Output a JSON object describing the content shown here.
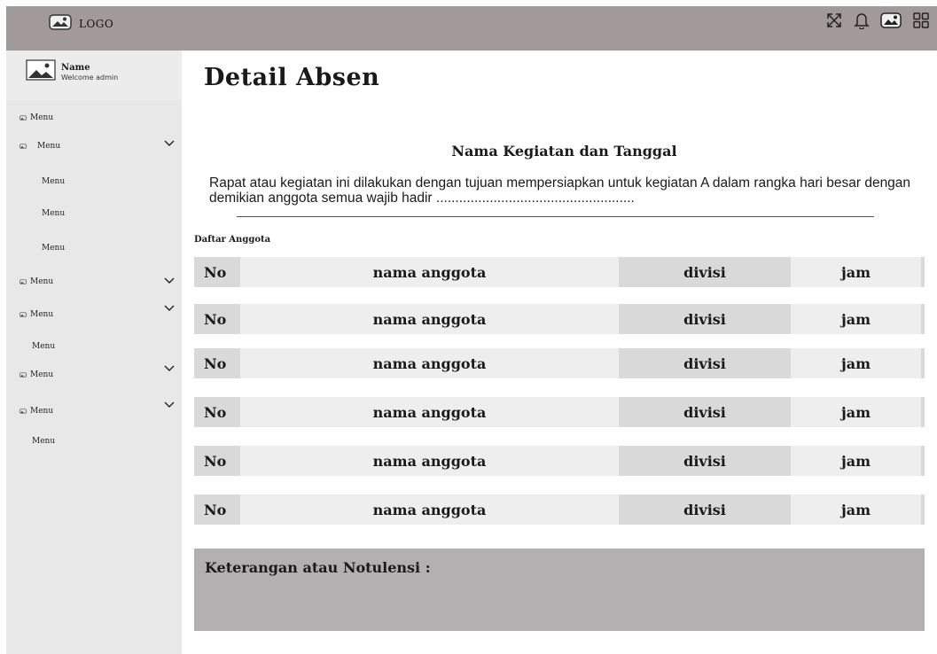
{
  "header": {
    "logo_text": "LOGO",
    "icons": [
      "fullscreen-icon",
      "bell-icon",
      "image-icon",
      "grid-icon"
    ]
  },
  "sidebar": {
    "profile": {
      "name": "Name",
      "welcome": "Welcome admin"
    },
    "items": [
      {
        "label": "Menu"
      },
      {
        "label": "Menu"
      },
      {
        "label": "Menu"
      },
      {
        "label": "Menu"
      },
      {
        "label": "Menu"
      },
      {
        "label": "Menu"
      },
      {
        "label": "Menu"
      },
      {
        "label": "Menu"
      },
      {
        "label": "Menu"
      },
      {
        "label": "Menu"
      },
      {
        "label": "Menu"
      }
    ]
  },
  "main": {
    "page_title": "Detail Absen",
    "event_title": "Nama Kegiatan dan Tanggal",
    "event_description": "Rapat atau kegiatan ini dilakukan dengan tujuan mempersiapkan untuk kegiatan A dalam rangka hari besar dengan demikian anggota semua wajib hadir ....................................................",
    "member_section_label": "Daftar Anggota",
    "rows": [
      {
        "no": "No",
        "name": "nama anggota",
        "division": "divisi",
        "time": "jam"
      },
      {
        "no": "No",
        "name": "nama anggota",
        "division": "divisi",
        "time": "jam"
      },
      {
        "no": "No",
        "name": "nama anggota",
        "division": "divisi",
        "time": "jam"
      },
      {
        "no": "No",
        "name": "nama anggota",
        "division": "divisi",
        "time": "jam"
      },
      {
        "no": "No",
        "name": "nama anggota",
        "division": "divisi",
        "time": "jam"
      },
      {
        "no": "No",
        "name": "nama anggota",
        "division": "divisi",
        "time": "jam"
      }
    ],
    "notes_label": "Keterangan atau Notulensi :"
  },
  "colors": {
    "topbar": "#a29a9a",
    "sidebar": "#e8e8e8",
    "notes_bg": "#b2b0b0",
    "cell_dark": "#d9d9d9",
    "cell_light": "#eeeeee"
  }
}
